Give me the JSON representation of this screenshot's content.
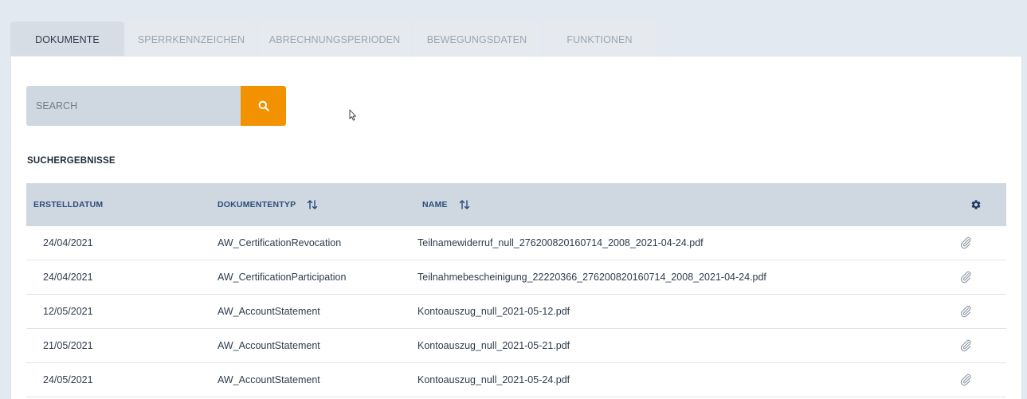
{
  "tabs": [
    {
      "label": "DOKUMENTE",
      "active": true
    },
    {
      "label": "SPERRKENNZEICHEN",
      "active": false
    },
    {
      "label": "ABRECHNUNGSPERIODEN",
      "active": false
    },
    {
      "label": "BEWEGUNGSDATEN",
      "active": false
    },
    {
      "label": "FUNKTIONEN",
      "active": false
    }
  ],
  "search": {
    "placeholder": "SEARCH",
    "value": "",
    "button_icon": "search-icon"
  },
  "results": {
    "heading": "SUCHERGEBNISSE",
    "columns": {
      "date": "ERSTELLDATUM",
      "type": "DOKUMENTENTYP",
      "name": "NAME",
      "settings_icon": "gear-icon",
      "sort_icon": "sort-arrows-icon"
    },
    "rows": [
      {
        "date": "24/04/2021",
        "type": "AW_CertificationRevocation",
        "name": "Teilnamewiderruf_null_276200820160714_2008_2021-04-24.pdf",
        "icon": "paperclip-icon"
      },
      {
        "date": "24/04/2021",
        "type": "AW_CertificationParticipation",
        "name": "Teilnahmebescheinigung_22220366_276200820160714_2008_2021-04-24.pdf",
        "icon": "paperclip-icon"
      },
      {
        "date": "12/05/2021",
        "type": "AW_AccountStatement",
        "name": "Kontoauszug_null_2021-05-12.pdf",
        "icon": "paperclip-icon"
      },
      {
        "date": "21/05/2021",
        "type": "AW_AccountStatement",
        "name": "Kontoauszug_null_2021-05-21.pdf",
        "icon": "paperclip-icon"
      },
      {
        "date": "24/05/2021",
        "type": "AW_AccountStatement",
        "name": "Kontoauszug_null_2021-05-24.pdf",
        "icon": "paperclip-icon"
      }
    ]
  },
  "colors": {
    "accent": "#f39200",
    "header_bg": "#cfd7e0",
    "header_text": "#2b4d7a",
    "page_bg": "#e3e9f0"
  }
}
